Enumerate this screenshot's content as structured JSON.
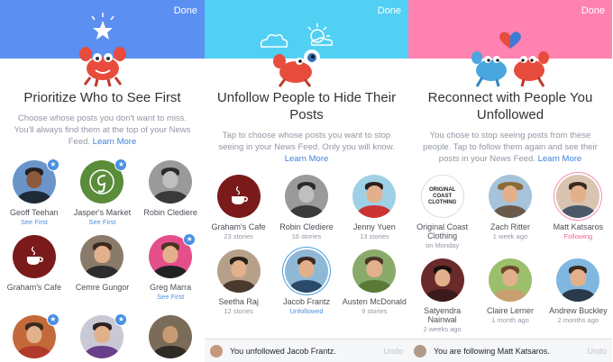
{
  "colors": {
    "blue": "#5b8ff2",
    "cyan": "#52d0f4",
    "pink": "#ff82b0",
    "link": "#3b83d8"
  },
  "screens": [
    {
      "done": "Done",
      "title": "Prioritize Who to See First",
      "desc": "Choose whose posts you don't want to miss. You'll always find them at the top of your News Feed.",
      "link": "Learn More",
      "people": [
        {
          "name": "Geoff Teehan",
          "sub": "See First",
          "star": true
        },
        {
          "name": "Jasper's Market",
          "sub": "See First",
          "star": true
        },
        {
          "name": "Robin Clediere",
          "sub": "",
          "star": false
        },
        {
          "name": "Graham's Cafe",
          "sub": "",
          "star": false
        },
        {
          "name": "Cemre Gungor",
          "sub": "",
          "star": false
        },
        {
          "name": "Greg Marra",
          "sub": "See First",
          "star": true
        }
      ]
    },
    {
      "done": "Done",
      "title": "Unfollow People to Hide Their Posts",
      "desc": "Tap to choose whose posts you want to stop seeing in your News Feed. Only you will know.",
      "link": "Learn More",
      "people": [
        {
          "name": "Graham's Cafe",
          "sub": "23 stories"
        },
        {
          "name": "Robin Clediere",
          "sub": "16 stories"
        },
        {
          "name": "Jenny Yuen",
          "sub": "13 stories"
        },
        {
          "name": "Seetha Raj",
          "sub": "12 stories"
        },
        {
          "name": "Jacob Frantz",
          "sub": "Unfollowed"
        },
        {
          "name": "Austen McDonald",
          "sub": "9 stories"
        }
      ],
      "toast": {
        "message": "You unfollowed Jacob Frantz.",
        "undo": "Undo"
      }
    },
    {
      "done": "Done",
      "title": "Reconnect with People You Unfollowed",
      "desc": "You chose to stop seeing posts from these people. Tap to follow them again and see their posts in your News Feed.",
      "link": "Learn More",
      "people": [
        {
          "name": "Original Coast Clothing",
          "sub": "on Monday",
          "logo": "ORIGINAL COAST CLOTHING"
        },
        {
          "name": "Zach Ritter",
          "sub": "1 week ago"
        },
        {
          "name": "Matt Katsaros",
          "sub": "Following"
        },
        {
          "name": "Satyendra Nainwal",
          "sub": "2 weeks ago"
        },
        {
          "name": "Claire Lerner",
          "sub": "1 month ago"
        },
        {
          "name": "Andrew Buckley",
          "sub": "2 months ago"
        }
      ],
      "toast": {
        "message": "You are following Matt Katsaros.",
        "undo": "Undo"
      }
    }
  ]
}
